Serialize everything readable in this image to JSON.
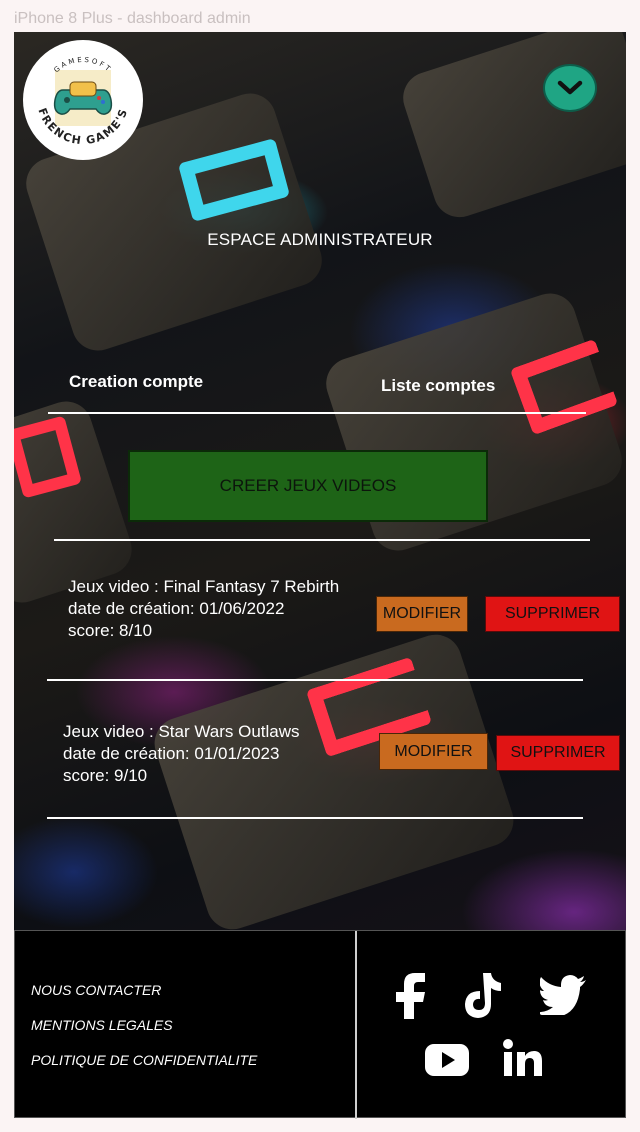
{
  "frame_label": "iPhone 8 Plus - dashboard admin",
  "logo": {
    "top_text": "GAMESOFT",
    "bottom_text": "FRENCH GAME'S"
  },
  "header": {
    "title": "ESPACE ADMINISTRATEUR"
  },
  "tabs": [
    {
      "label": "Creation compte"
    },
    {
      "label": "Liste comptes"
    }
  ],
  "create_button": {
    "label": "CREER JEUX VIDEOS"
  },
  "games": [
    {
      "title_line": "Jeux video : Final Fantasy 7 Rebirth",
      "date_line": "date de création: 01/06/2022",
      "score_line": "score: 8/10",
      "modify_label": "MODIFIER",
      "delete_label": "SUPPRIMER"
    },
    {
      "title_line": "Jeux video : Star Wars Outlaws",
      "date_line": "date de création: 01/01/2023",
      "score_line": "score: 9/10",
      "modify_label": "MODIFIER",
      "delete_label": "SUPPRIMER"
    }
  ],
  "footer": {
    "links": [
      "NOUS CONTACTER",
      "MENTIONS LEGALES",
      "POLITIQUE DE CONFIDENTIALITE"
    ],
    "socials": [
      "facebook-icon",
      "tiktok-icon",
      "twitter-icon",
      "youtube-icon",
      "linkedin-icon"
    ]
  },
  "colors": {
    "accent_green": "#1fa584",
    "create_button": "#1e6417",
    "modify_button": "#c96a1f",
    "delete_button": "#e01414"
  }
}
